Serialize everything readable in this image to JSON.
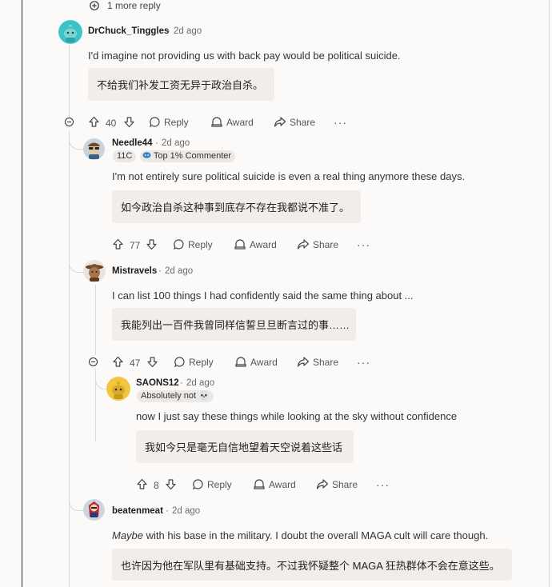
{
  "top_reply": {
    "label": "1 more reply"
  },
  "comments": [
    {
      "username": "DrChuck_Tinggles",
      "time": "2d ago",
      "text": "I'd imagine not providing us with back pay would be political suicide.",
      "translation": "不给我们补发工资无异于政治自杀。",
      "votes": "40",
      "avatar_icon": "snoo-teal-avatar"
    },
    {
      "username": "Needle44",
      "time": "2d ago",
      "badges": [
        "11C",
        "Top 1% Commenter"
      ],
      "text": "I'm not entirely sure political suicide is even a real thing anymore these days.",
      "translation": "如今政治自杀这种事到底存不存在我都说不准了。",
      "votes": "77",
      "avatar_icon": "sunglasses-avatar"
    },
    {
      "username": "Mistravels",
      "time": "2d ago",
      "text": "I can list 100 things I had confidently said the same thing about ...",
      "translation": "我能列出一百件我曾同样信誓旦旦断言过的事……",
      "votes": "47",
      "avatar_icon": "cowboy-avatar"
    },
    {
      "username": "SAONS12",
      "time": "2d ago",
      "badges": [
        "Absolutely not 💀"
      ],
      "text": "now I just say these things while looking at the sky without confidence",
      "translation": "我如今只是毫无自信地望着天空说着这些话",
      "votes": "8",
      "avatar_icon": "snoo-yellow-avatar"
    },
    {
      "username": "beatenmeat",
      "time": "2d ago",
      "text_italic": "Maybe",
      "text": " with his base in the military. I doubt the overall MAGA cult will care though.",
      "translation": "也许因为他在军队里有基础支持。不过我怀疑整个 MAGA 狂热群体不会在意这些。",
      "avatar_icon": "red-hero-avatar"
    }
  ],
  "actions": {
    "reply": "Reply",
    "award": "Award",
    "share": "Share",
    "more": "···"
  },
  "separator": "·",
  "colors": {
    "background": "#fbfaf8",
    "translation_box": "#f2ecea",
    "thread_line": "#d9d9d9",
    "text": "#1c1c1c",
    "muted": "#6b6b6b"
  }
}
